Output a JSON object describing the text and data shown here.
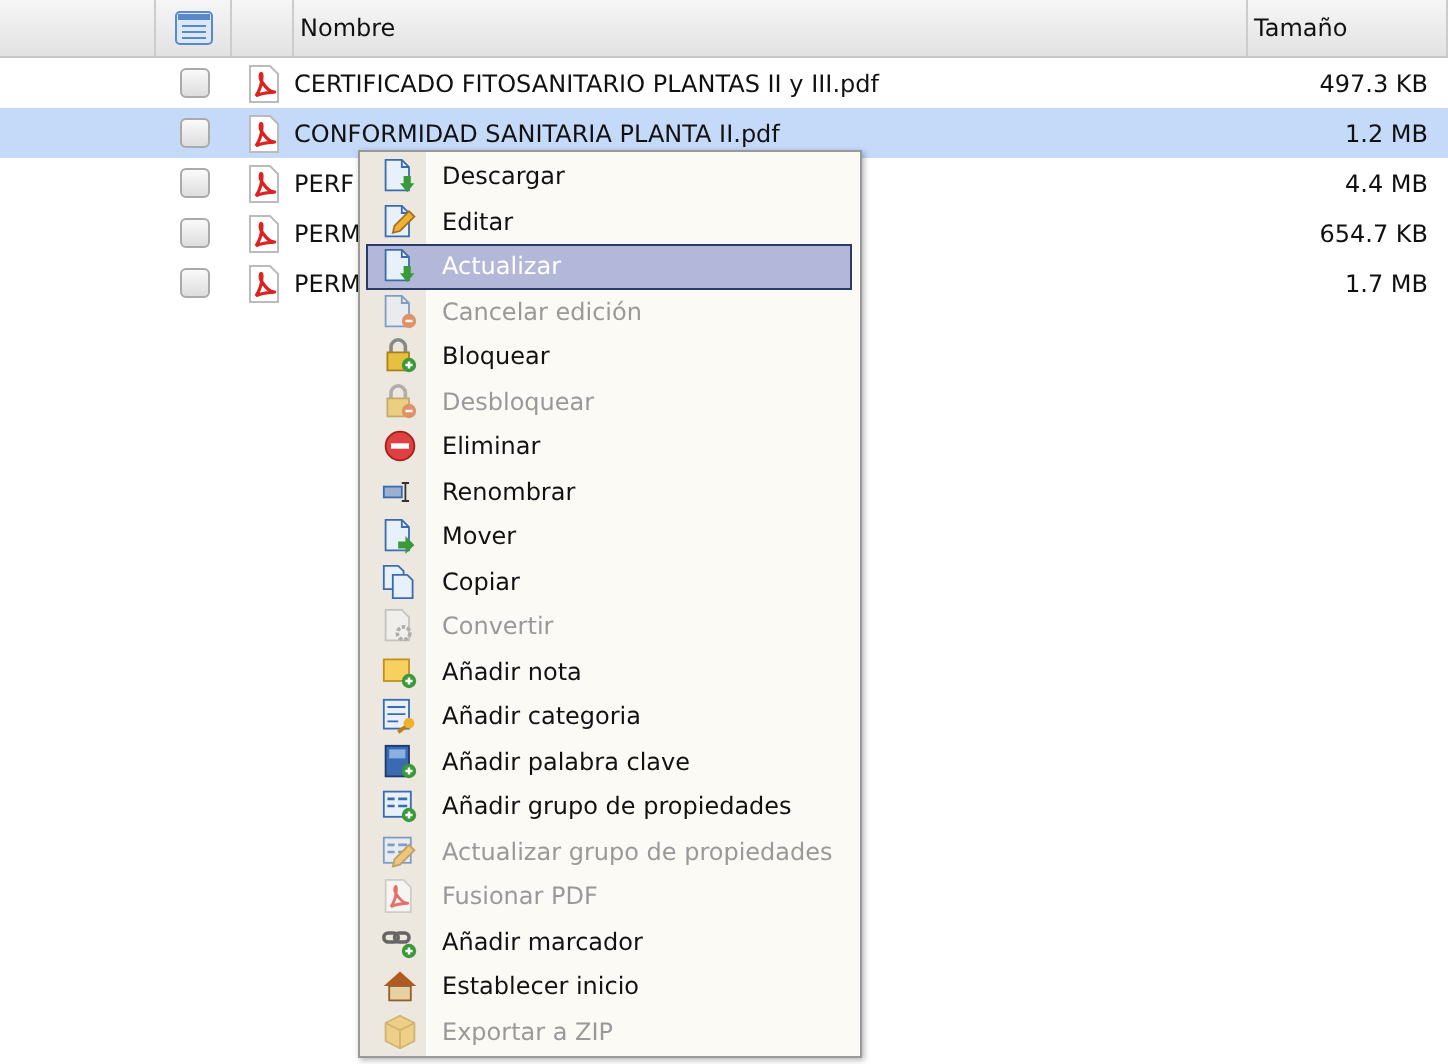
{
  "table": {
    "columns": [
      "Nombre",
      "Tamaño"
    ],
    "rows": [
      {
        "name": "CERTIFICADO FITOSANITARIO PLANTAS II y III.pdf",
        "size": "497.3 KB",
        "checked": false,
        "selected": false
      },
      {
        "name": "CONFORMIDAD SANITARIA PLANTA II.pdf",
        "size": "1.2 MB",
        "checked": false,
        "selected": true
      },
      {
        "name": "PERF",
        "size": "4.4 MB",
        "checked": false,
        "selected": false
      },
      {
        "name": "PERM",
        "size": "654.7 KB",
        "checked": false,
        "selected": false
      },
      {
        "name": "PERM",
        "size": "1.7 MB",
        "checked": false,
        "selected": false
      }
    ]
  },
  "context_menu": {
    "items": [
      {
        "label": "Descargar",
        "disabled": false,
        "selected": false
      },
      {
        "label": "Editar",
        "disabled": false,
        "selected": false
      },
      {
        "label": "Actualizar",
        "disabled": false,
        "selected": true
      },
      {
        "label": "Cancelar edición",
        "disabled": true,
        "selected": false
      },
      {
        "label": "Bloquear",
        "disabled": false,
        "selected": false
      },
      {
        "label": "Desbloquear",
        "disabled": true,
        "selected": false
      },
      {
        "label": "Eliminar",
        "disabled": false,
        "selected": false
      },
      {
        "label": "Renombrar",
        "disabled": false,
        "selected": false
      },
      {
        "label": "Mover",
        "disabled": false,
        "selected": false
      },
      {
        "label": "Copiar",
        "disabled": false,
        "selected": false
      },
      {
        "label": "Convertir",
        "disabled": true,
        "selected": false
      },
      {
        "label": "Añadir nota",
        "disabled": false,
        "selected": false
      },
      {
        "label": "Añadir categoria",
        "disabled": false,
        "selected": false
      },
      {
        "label": "Añadir palabra clave",
        "disabled": false,
        "selected": false
      },
      {
        "label": "Añadir grupo de propiedades",
        "disabled": false,
        "selected": false
      },
      {
        "label": "Actualizar grupo de propiedades",
        "disabled": true,
        "selected": false
      },
      {
        "label": "Fusionar PDF",
        "disabled": true,
        "selected": false
      },
      {
        "label": "Añadir marcador",
        "disabled": false,
        "selected": false
      },
      {
        "label": "Establecer inicio",
        "disabled": false,
        "selected": false
      },
      {
        "label": "Exportar a ZIP",
        "disabled": true,
        "selected": false
      }
    ]
  }
}
